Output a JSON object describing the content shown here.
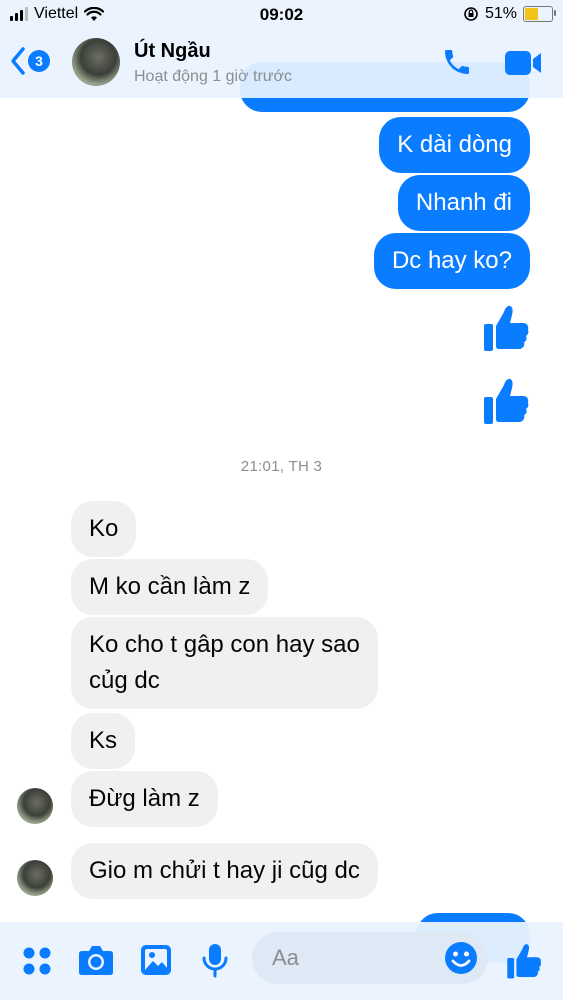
{
  "status_bar": {
    "carrier": "Viettel",
    "time": "09:02",
    "battery_percent": "51%",
    "battery_level": 0.51,
    "battery_color": "#f2c318"
  },
  "header": {
    "back_badge": "3",
    "contact_name": "Út Ngầu",
    "contact_status": "Hoạt động 1 giờ trước",
    "icons": [
      "back-chevron-icon",
      "phone-icon",
      "video-camera-icon"
    ]
  },
  "messages": {
    "outgoing": [
      {
        "text": "K dài dòng"
      },
      {
        "text": "Nhanh đi"
      },
      {
        "text": "Dc hay ko?"
      }
    ],
    "likes_count": 2,
    "divider_time": "21:01, TH 3",
    "incoming": [
      {
        "text": "Ko"
      },
      {
        "text": "M ko cần làm z"
      },
      {
        "text_line1": "Ko cho t gâp con hay sao",
        "text_line2": "củg dc"
      },
      {
        "text": "Ks"
      },
      {
        "text": "Đừg làm z"
      },
      {
        "text": "Gio m chửi t hay ji cũg dc"
      }
    ]
  },
  "composer": {
    "placeholder": "Aa",
    "icons": [
      "apps-grid-icon",
      "camera-icon",
      "photo-icon",
      "microphone-icon",
      "emoji-icon",
      "thumbs-up-icon"
    ]
  },
  "colors": {
    "accent": "#0a7cff",
    "incoming_bubble": "#f0f0f0",
    "bar_background": "#eaf3fe",
    "muted_text": "#8a8d91"
  }
}
